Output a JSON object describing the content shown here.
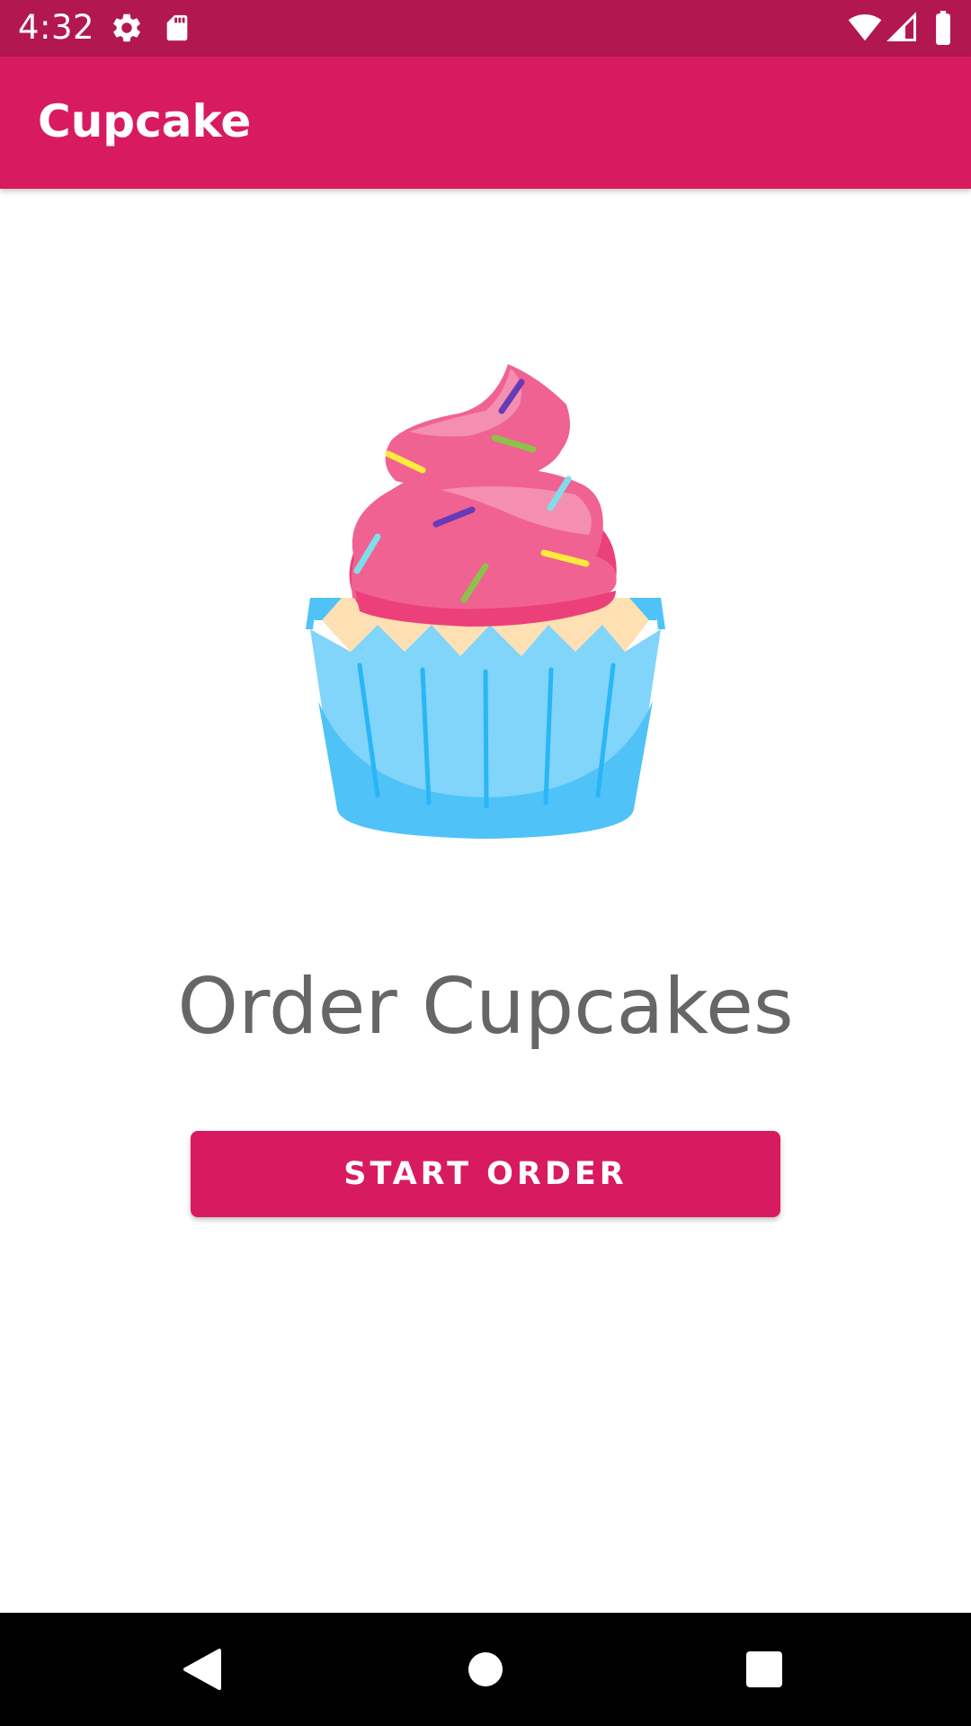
{
  "status_bar": {
    "time": "4:32",
    "icons": [
      "gear-icon",
      "sd-card-icon",
      "wifi-icon",
      "signal-icon",
      "battery-icon"
    ],
    "background": "#b3174f"
  },
  "app_bar": {
    "title": "Cupcake",
    "background": "#d81b60"
  },
  "main": {
    "image": "cupcake-illustration",
    "heading": "Order Cupcakes",
    "start_button_label": "START ORDER",
    "accent_color": "#d81b60"
  },
  "nav_bar": {
    "buttons": [
      "back-icon",
      "home-icon",
      "recents-icon"
    ]
  }
}
